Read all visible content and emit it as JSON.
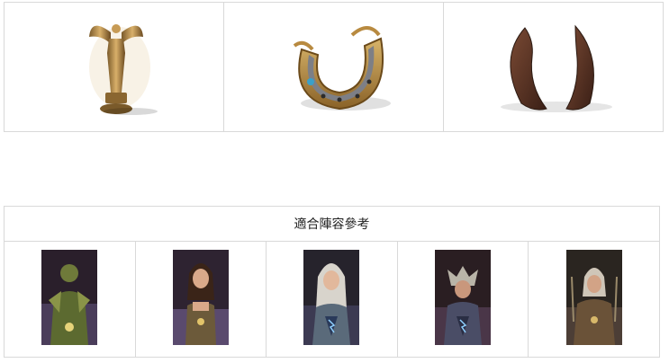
{
  "items": [
    {
      "name": "winged-angel-statuette",
      "icon": "statuette-icon"
    },
    {
      "name": "jeweled-horseshoe",
      "icon": "horseshoe-icon"
    },
    {
      "name": "pair-of-horns",
      "icon": "horns-icon"
    }
  ],
  "lineup": {
    "title": "適合陣容參考",
    "heroes": [
      {
        "name": "hero-1",
        "bg": "#2a1f2b"
      },
      {
        "name": "hero-2",
        "bg": "#2e2331"
      },
      {
        "name": "hero-3",
        "bg": "#26232c"
      },
      {
        "name": "hero-4",
        "bg": "#2a1e22"
      },
      {
        "name": "hero-5",
        "bg": "#2a2520"
      }
    ]
  }
}
